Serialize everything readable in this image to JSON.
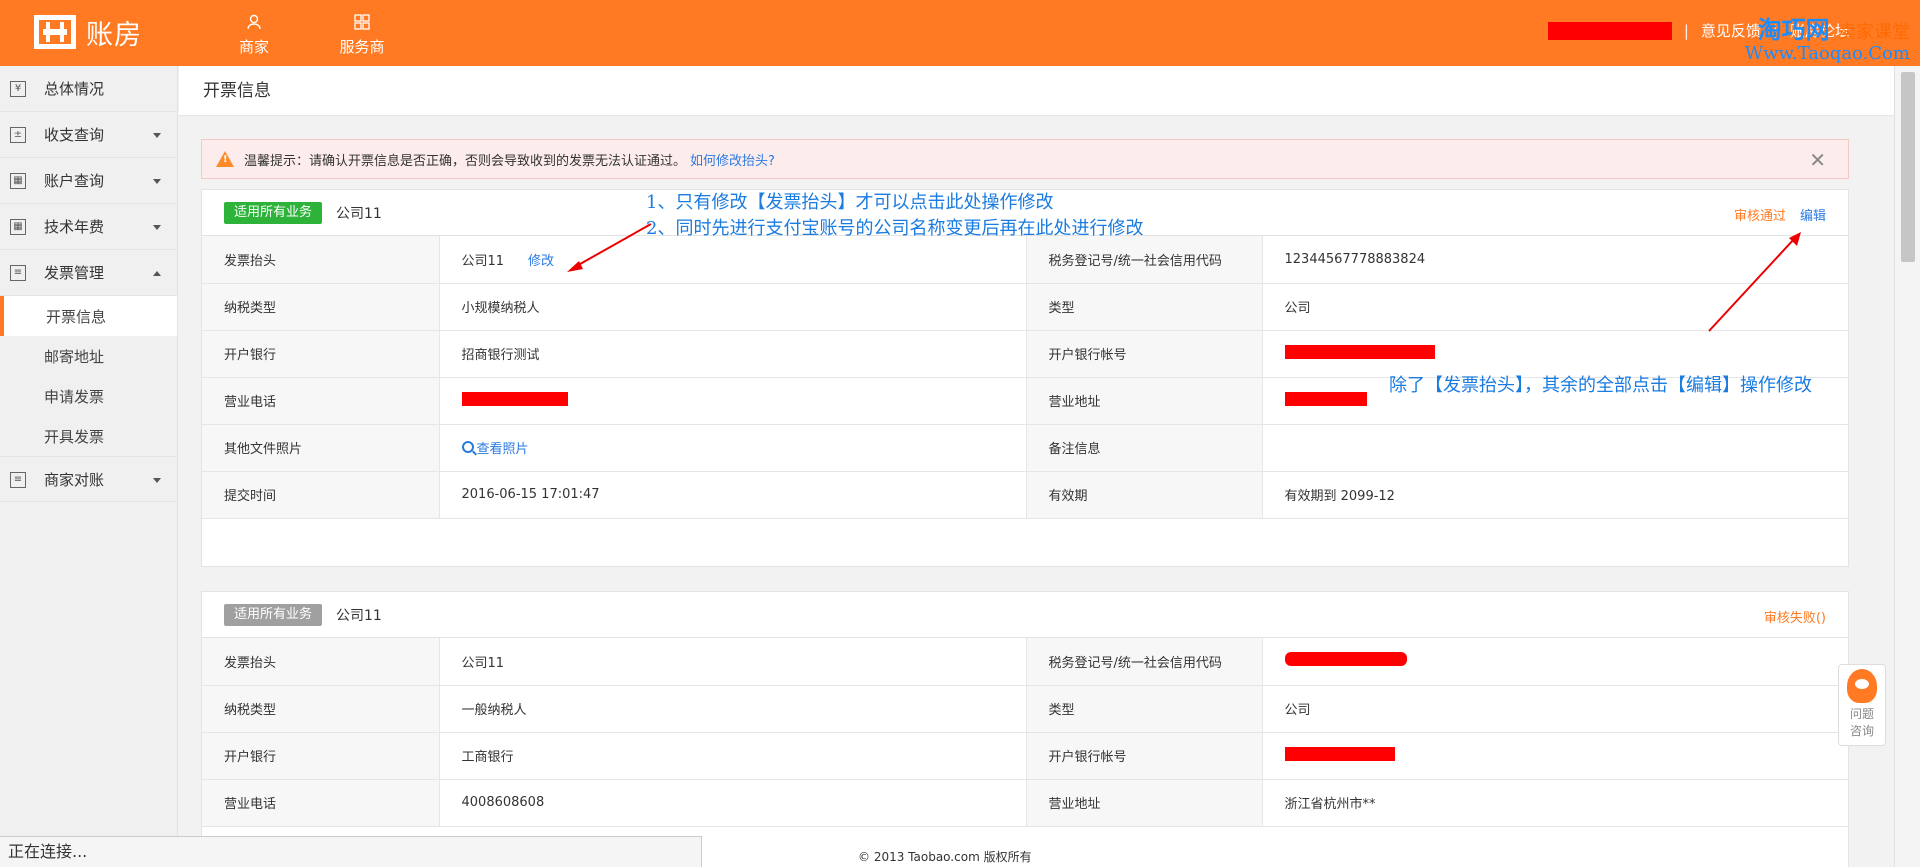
{
  "app": {
    "logo_text": "账房"
  },
  "topnav": [
    {
      "label": "商家",
      "icon": "user-icon"
    },
    {
      "label": "服务商",
      "icon": "grid-icon"
    }
  ],
  "top_right": {
    "feedback": "意见反馈",
    "forum": "账房论坛"
  },
  "watermark": {
    "line1": "淘巧网",
    "line1_small": "卖家课堂",
    "line2": "Www.Taoqao.Com"
  },
  "sidebar": {
    "items": [
      {
        "label": "总体情况",
        "icon": "yen-icon"
      },
      {
        "label": "收支查询",
        "icon": "doc-icon"
      },
      {
        "label": "账户查询",
        "icon": "calc-icon"
      },
      {
        "label": "技术年费",
        "icon": "calc-icon"
      },
      {
        "label": "发票管理",
        "icon": "invoice-icon"
      }
    ],
    "sub_items": [
      "开票信息",
      "邮寄地址",
      "申请发票",
      "开具发票"
    ],
    "last_item": {
      "label": "商家对账",
      "icon": "invoice-icon"
    }
  },
  "page": {
    "title": "开票信息"
  },
  "alert": {
    "text": "温馨提示：请确认开票信息是否正确，否则会导致收到的发票无法认证通过。",
    "link": "如何修改抬头?",
    "close": "✕"
  },
  "card1": {
    "tag": "适用所有业务",
    "company": "公司11",
    "status": "审核通过",
    "edit": "编辑",
    "modify_link": "修改",
    "photo_link": "查看照片",
    "rows": [
      {
        "k1": "发票抬头",
        "v1": "公司11",
        "k2": "税务登记号/统一社会信用代码",
        "v2": "12344567778883824"
      },
      {
        "k1": "纳税类型",
        "v1": "小规模纳税人",
        "k2": "类型",
        "v2": "公司"
      },
      {
        "k1": "开户银行",
        "v1": "招商银行测试",
        "k2": "开户银行帐号",
        "v2": ""
      },
      {
        "k1": "营业电话",
        "v1": "",
        "k2": "营业地址",
        "v2": ""
      },
      {
        "k1": "其他文件照片",
        "v1": "",
        "k2": "备注信息",
        "v2": ""
      },
      {
        "k1": "提交时间",
        "v1": "2016-06-15 17:01:47",
        "k2": "有效期",
        "v2": "有效期到 2099-12"
      }
    ]
  },
  "card2": {
    "tag": "适用所有业务",
    "company": "公司11",
    "status": "审核失败()",
    "rows": [
      {
        "k1": "发票抬头",
        "v1": "公司11",
        "k2": "税务登记号/统一社会信用代码",
        "v2": ""
      },
      {
        "k1": "纳税类型",
        "v1": "一般纳税人",
        "k2": "类型",
        "v2": "公司"
      },
      {
        "k1": "开户银行",
        "v1": "工商银行",
        "k2": "开户银行帐号",
        "v2": ""
      },
      {
        "k1": "营业电话",
        "v1": "4008608608",
        "k2": "营业地址",
        "v2": "浙江省杭州市**"
      }
    ]
  },
  "annotations": {
    "a1": "1、只有修改【发票抬头】才可以点击此处操作修改",
    "a2": "2、同时先进行支付宝账号的公司名称变更后再在此处进行修改",
    "a3": "除了【发票抬头】，其余的全部点击【编辑】操作修改",
    "color": "#1a7be0"
  },
  "float_help": {
    "label1": "问题",
    "label2": "咨询"
  },
  "statusbar": {
    "text": "正在连接..."
  },
  "footer": {
    "copyright": "© 2013 Taobao.com 版权所有"
  },
  "colors": {
    "brand": "#ff7a22",
    "link": "#2a7ae2",
    "success": "#2db23a",
    "redact": "#ff0000"
  }
}
